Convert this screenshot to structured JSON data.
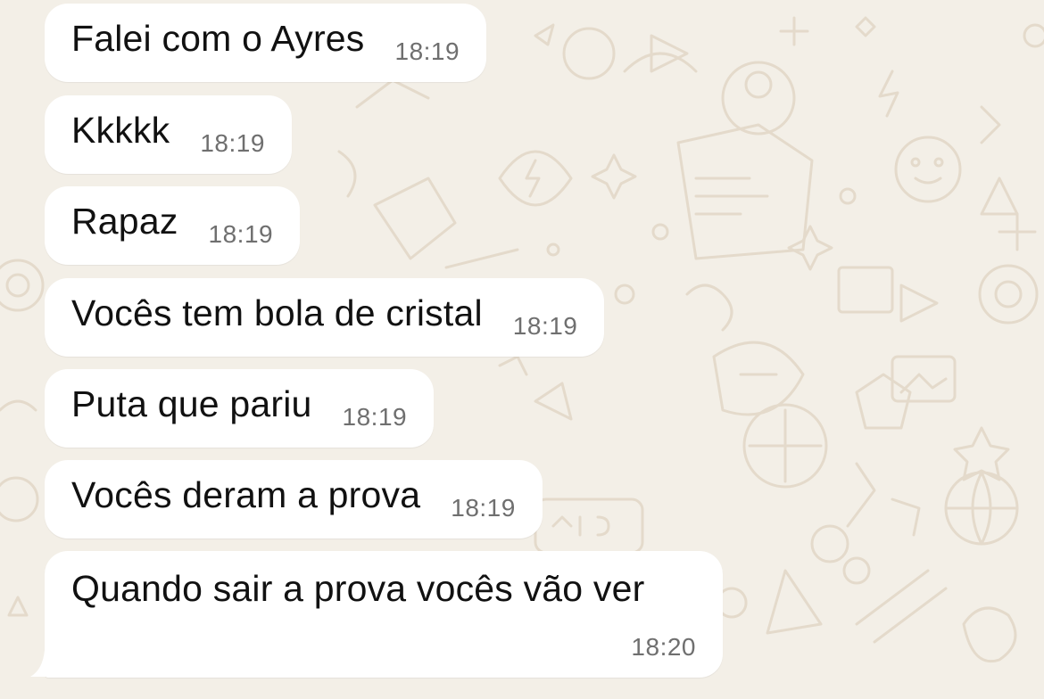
{
  "chat": {
    "messages": [
      {
        "text": "Falei com o Ayres",
        "time": "18:19"
      },
      {
        "text": "Kkkkk",
        "time": "18:19"
      },
      {
        "text": "Rapaz",
        "time": "18:19"
      },
      {
        "text": "Vocês tem bola de cristal",
        "time": "18:19"
      },
      {
        "text": "Puta que pariu",
        "time": "18:19"
      },
      {
        "text": "Vocês deram a prova",
        "time": "18:19"
      },
      {
        "text": "Quando sair a prova vocês vão ver",
        "time": "18:20"
      }
    ]
  },
  "theme": {
    "wallpaper_color": "#f3efe7",
    "wallpaper_doodle_color": "#e6ddd0",
    "bubble_color": "#ffffff",
    "text_color": "#111111",
    "time_color": "#6f6f6f"
  }
}
